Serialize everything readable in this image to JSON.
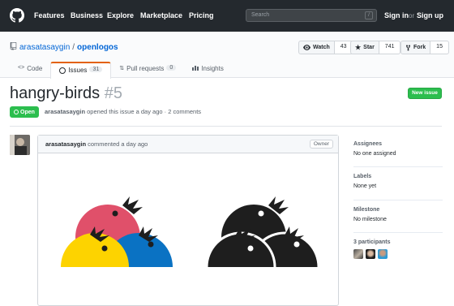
{
  "header": {
    "nav": [
      "Features",
      "Business",
      "Explore",
      "Marketplace",
      "Pricing"
    ],
    "search_placeholder": "Search",
    "search_key": "/",
    "sign_in": "Sign in",
    "or": "or",
    "sign_up": "Sign up"
  },
  "repo": {
    "owner": "arasatasaygin",
    "separator": "/",
    "name": "openlogos",
    "watch_label": "Watch",
    "watch_count": "43",
    "star_label": "Star",
    "star_count": "741",
    "fork_label": "Fork",
    "fork_count": "15"
  },
  "tabs": {
    "code": "Code",
    "issues": "Issues",
    "issues_count": "31",
    "pulls": "Pull requests",
    "pulls_count": "0",
    "insights": "Insights"
  },
  "issue": {
    "title": "hangry-birds",
    "number": "#5",
    "state": "Open",
    "author": "arasatasaygin",
    "meta": "opened this issue a day ago · 2 comments",
    "new_issue": "New issue"
  },
  "comment": {
    "author": "arasatasaygin",
    "action": "commented a day ago",
    "badge": "Owner"
  },
  "sidebar": {
    "assignees_h": "Assignees",
    "assignees_v": "No one assigned",
    "labels_h": "Labels",
    "labels_v": "None yet",
    "milestone_h": "Milestone",
    "milestone_v": "No milestone",
    "participants_h": "3 participants"
  },
  "colors": {
    "header_bg": "#24292e",
    "link": "#0366d6",
    "open_green": "#2cbe4e",
    "tab_accent": "#e36209",
    "bird_pink": "#e0506a",
    "bird_blue": "#0a72c3",
    "bird_yellow": "#fdd300",
    "bird_black": "#1e1e1e"
  }
}
